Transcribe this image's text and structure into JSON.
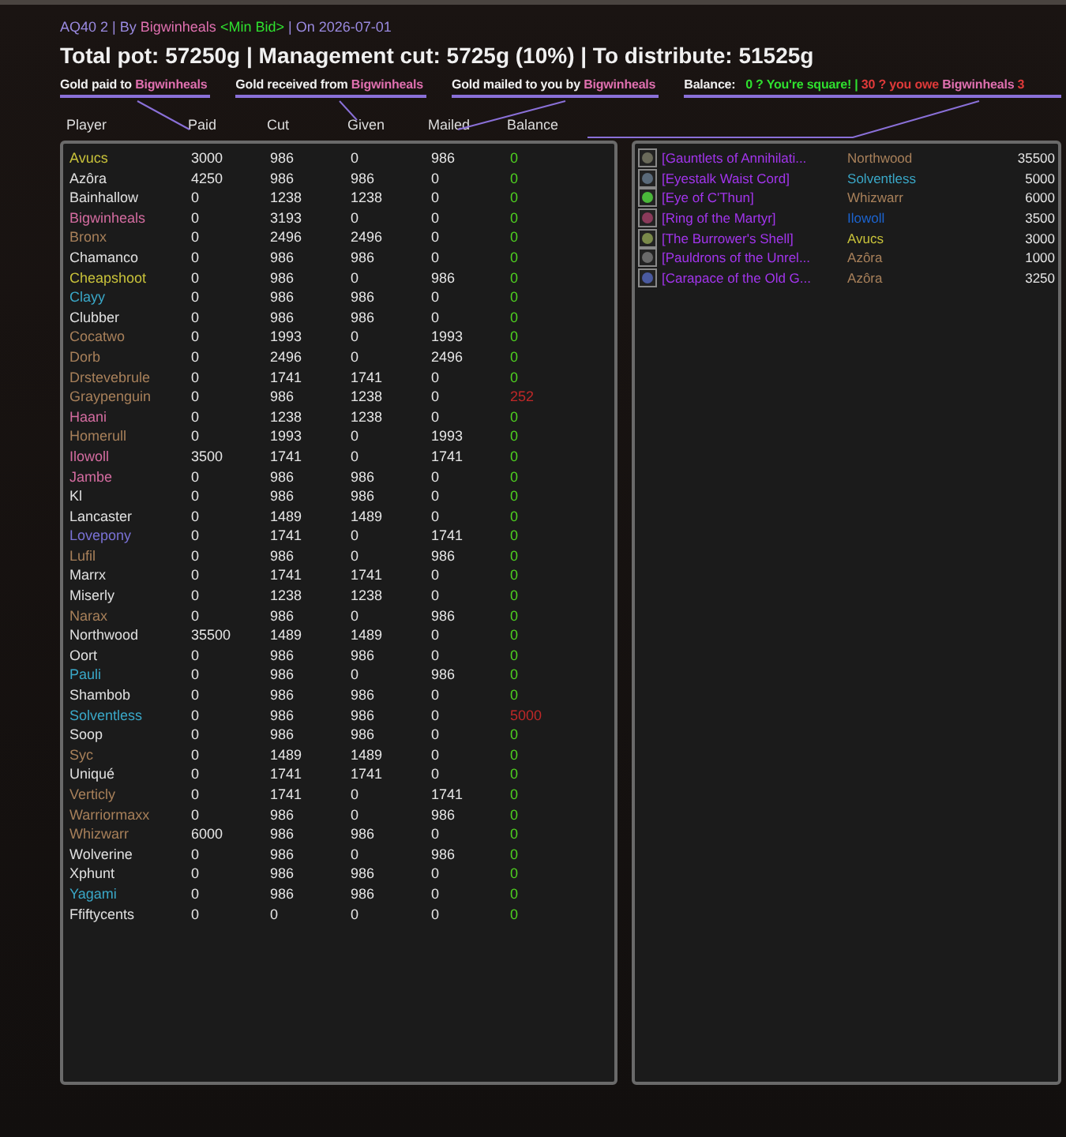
{
  "header": {
    "raid": "AQ40 2 |",
    "by_label": "By",
    "author": "Bigwinheals",
    "bid_mode": "<Min Bid>",
    "date_label": "| On 2026-07-01",
    "summary": "Total pot: 57250g | Management cut: 5725g (10%) | To distribute: 51525g"
  },
  "legend": [
    {
      "kind": "plain",
      "text": "Gold paid to",
      "name": "Bigwinheals"
    },
    {
      "kind": "plain",
      "text": "Gold received from",
      "name": "Bigwinheals"
    },
    {
      "kind": "plain",
      "text": "Gold mailed to you by",
      "name": "Bigwinheals"
    },
    {
      "kind": "balance",
      "text": "Balance:",
      "square": "0 ? You're square!",
      "separator": "|",
      "owe": "30 ? you owe",
      "name": "Bigwinheals",
      "tail": "3"
    }
  ],
  "columns": [
    "Player",
    "Paid",
    "Cut",
    "Given",
    "Mailed",
    "Balance"
  ],
  "rows": [
    {
      "player": "Avucs",
      "color": "#c8c23a",
      "paid": "3000",
      "cut": "986",
      "given": "0",
      "mailed": "986",
      "balance": "0",
      "due": false
    },
    {
      "player": "Azôra",
      "color": "#e0e0e0",
      "paid": "4250",
      "cut": "986",
      "given": "986",
      "mailed": "0",
      "balance": "0",
      "due": false
    },
    {
      "player": "Bainhallow",
      "color": "#e0e0e0",
      "paid": "0",
      "cut": "1238",
      "given": "1238",
      "mailed": "0",
      "balance": "0",
      "due": false
    },
    {
      "player": "Bigwinheals",
      "color": "#d46ca0",
      "paid": "0",
      "cut": "3193",
      "given": "0",
      "mailed": "0",
      "balance": "0",
      "due": false
    },
    {
      "player": "Bronx",
      "color": "#a8805a",
      "paid": "0",
      "cut": "2496",
      "given": "2496",
      "mailed": "0",
      "balance": "0",
      "due": false
    },
    {
      "player": "Chamanco",
      "color": "#e0e0e0",
      "paid": "0",
      "cut": "986",
      "given": "986",
      "mailed": "0",
      "balance": "0",
      "due": false
    },
    {
      "player": "Cheapshoot",
      "color": "#c8c23a",
      "paid": "0",
      "cut": "986",
      "given": "0",
      "mailed": "986",
      "balance": "0",
      "due": false
    },
    {
      "player": "Clayy",
      "color": "#3aa8c8",
      "paid": "0",
      "cut": "986",
      "given": "986",
      "mailed": "0",
      "balance": "0",
      "due": false
    },
    {
      "player": "Clubber",
      "color": "#e0e0e0",
      "paid": "0",
      "cut": "986",
      "given": "986",
      "mailed": "0",
      "balance": "0",
      "due": false
    },
    {
      "player": "Cocatwo",
      "color": "#a8805a",
      "paid": "0",
      "cut": "1993",
      "given": "0",
      "mailed": "1993",
      "balance": "0",
      "due": false
    },
    {
      "player": "Dorb",
      "color": "#a8805a",
      "paid": "0",
      "cut": "2496",
      "given": "0",
      "mailed": "2496",
      "balance": "0",
      "due": false
    },
    {
      "player": "Drstevebrule",
      "color": "#a8805a",
      "paid": "0",
      "cut": "1741",
      "given": "1741",
      "mailed": "0",
      "balance": "0",
      "due": false
    },
    {
      "player": "Graypenguin",
      "color": "#a8805a",
      "paid": "0",
      "cut": "986",
      "given": "1238",
      "mailed": "0",
      "balance": "252",
      "due": true
    },
    {
      "player": "Haani",
      "color": "#d46ca0",
      "paid": "0",
      "cut": "1238",
      "given": "1238",
      "mailed": "0",
      "balance": "0",
      "due": false
    },
    {
      "player": "Homerull",
      "color": "#a8805a",
      "paid": "0",
      "cut": "1993",
      "given": "0",
      "mailed": "1993",
      "balance": "0",
      "due": false
    },
    {
      "player": "Ilowoll",
      "color": "#d46ca0",
      "paid": "3500",
      "cut": "1741",
      "given": "0",
      "mailed": "1741",
      "balance": "0",
      "due": false
    },
    {
      "player": "Jambe",
      "color": "#d46ca0",
      "paid": "0",
      "cut": "986",
      "given": "986",
      "mailed": "0",
      "balance": "0",
      "due": false
    },
    {
      "player": "Kl",
      "color": "#e0e0e0",
      "paid": "0",
      "cut": "986",
      "given": "986",
      "mailed": "0",
      "balance": "0",
      "due": false
    },
    {
      "player": "Lancaster",
      "color": "#e0e0e0",
      "paid": "0",
      "cut": "1489",
      "given": "1489",
      "mailed": "0",
      "balance": "0",
      "due": false
    },
    {
      "player": "Lovepony",
      "color": "#7a72d6",
      "paid": "0",
      "cut": "1741",
      "given": "0",
      "mailed": "1741",
      "balance": "0",
      "due": false
    },
    {
      "player": "Lufil",
      "color": "#a8805a",
      "paid": "0",
      "cut": "986",
      "given": "0",
      "mailed": "986",
      "balance": "0",
      "due": false
    },
    {
      "player": "Marrx",
      "color": "#e0e0e0",
      "paid": "0",
      "cut": "1741",
      "given": "1741",
      "mailed": "0",
      "balance": "0",
      "due": false
    },
    {
      "player": "Miserly",
      "color": "#e0e0e0",
      "paid": "0",
      "cut": "1238",
      "given": "1238",
      "mailed": "0",
      "balance": "0",
      "due": false
    },
    {
      "player": "Narax",
      "color": "#a8805a",
      "paid": "0",
      "cut": "986",
      "given": "0",
      "mailed": "986",
      "balance": "0",
      "due": false
    },
    {
      "player": "Northwood",
      "color": "#e0e0e0",
      "paid": "35500",
      "cut": "1489",
      "given": "1489",
      "mailed": "0",
      "balance": "0",
      "due": false
    },
    {
      "player": "Oort",
      "color": "#e0e0e0",
      "paid": "0",
      "cut": "986",
      "given": "986",
      "mailed": "0",
      "balance": "0",
      "due": false
    },
    {
      "player": "Pauli",
      "color": "#3aa8c8",
      "paid": "0",
      "cut": "986",
      "given": "0",
      "mailed": "986",
      "balance": "0",
      "due": false
    },
    {
      "player": "Shambob",
      "color": "#e0e0e0",
      "paid": "0",
      "cut": "986",
      "given": "986",
      "mailed": "0",
      "balance": "0",
      "due": false
    },
    {
      "player": "Solventless",
      "color": "#3aa8c8",
      "paid": "0",
      "cut": "986",
      "given": "986",
      "mailed": "0",
      "balance": "5000",
      "due": true
    },
    {
      "player": "Soop",
      "color": "#e0e0e0",
      "paid": "0",
      "cut": "986",
      "given": "986",
      "mailed": "0",
      "balance": "0",
      "due": false
    },
    {
      "player": "Syc",
      "color": "#a8805a",
      "paid": "0",
      "cut": "1489",
      "given": "1489",
      "mailed": "0",
      "balance": "0",
      "due": false
    },
    {
      "player": "Uniqué",
      "color": "#e0e0e0",
      "paid": "0",
      "cut": "1741",
      "given": "1741",
      "mailed": "0",
      "balance": "0",
      "due": false
    },
    {
      "player": "Verticly",
      "color": "#a8805a",
      "paid": "0",
      "cut": "1741",
      "given": "0",
      "mailed": "1741",
      "balance": "0",
      "due": false
    },
    {
      "player": "Warriormaxx",
      "color": "#a8805a",
      "paid": "0",
      "cut": "986",
      "given": "0",
      "mailed": "986",
      "balance": "0",
      "due": false
    },
    {
      "player": "Whizwarr",
      "color": "#a8805a",
      "paid": "6000",
      "cut": "986",
      "given": "986",
      "mailed": "0",
      "balance": "0",
      "due": false
    },
    {
      "player": "Wolverine",
      "color": "#e0e0e0",
      "paid": "0",
      "cut": "986",
      "given": "0",
      "mailed": "986",
      "balance": "0",
      "due": false
    },
    {
      "player": "Xphunt",
      "color": "#e0e0e0",
      "paid": "0",
      "cut": "986",
      "given": "986",
      "mailed": "0",
      "balance": "0",
      "due": false
    },
    {
      "player": "Yagami",
      "color": "#3aa8c8",
      "paid": "0",
      "cut": "986",
      "given": "986",
      "mailed": "0",
      "balance": "0",
      "due": false
    },
    {
      "player": "Ffiftycents",
      "color": "#e0e0e0",
      "paid": "0",
      "cut": "0",
      "given": "0",
      "mailed": "0",
      "balance": "0",
      "due": false
    }
  ],
  "loot": [
    {
      "item": "[Gauntlets of Annihilati...",
      "winner": "Northwood",
      "color": "#a8805a",
      "price": "35500"
    },
    {
      "item": "[Eyestalk Waist Cord]",
      "winner": "Solventless",
      "color": "#3aa8c8",
      "price": "5000"
    },
    {
      "item": "[Eye of C'Thun]",
      "winner": "Whizwarr",
      "color": "#a8805a",
      "price": "6000"
    },
    {
      "item": "[Ring of the Martyr]",
      "winner": "Ilowoll",
      "color": "#1c64d0",
      "price": "3500"
    },
    {
      "item": "[The Burrower's Shell]",
      "winner": "Avucs",
      "color": "#c8c23a",
      "price": "3000"
    },
    {
      "item": "[Pauldrons of the Unrel...",
      "winner": "Azôra",
      "color": "#a8805a",
      "price": "1000"
    },
    {
      "item": "[Carapace of the Old G...",
      "winner": "Azôra",
      "color": "#a8805a",
      "price": "3250"
    }
  ]
}
